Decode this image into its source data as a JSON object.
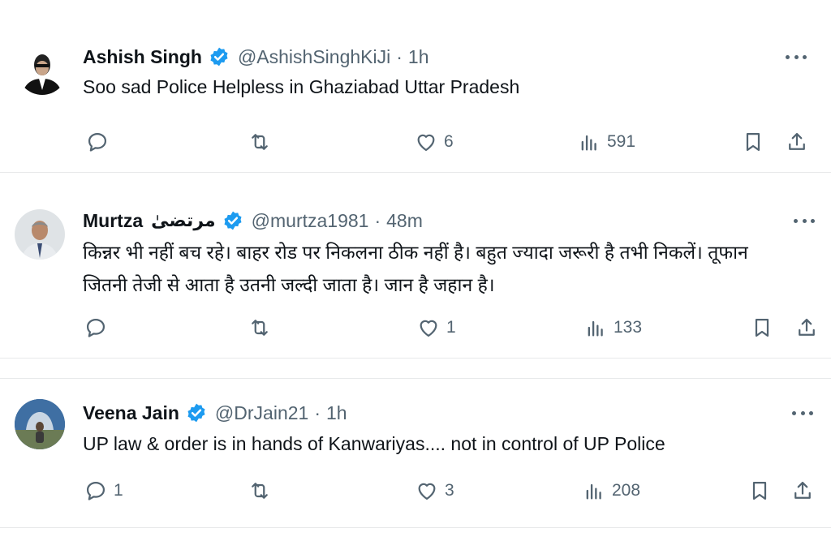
{
  "tweets": [
    {
      "name": "Ashish Singh",
      "name_alt": "",
      "handle": "@AshishSinghKiJi",
      "time": "1h",
      "text": "Soo sad Police Helpless in Ghaziabad Uttar Pradesh",
      "reply_count": "",
      "retweet_count": "",
      "like_count": "6",
      "view_count": "591"
    },
    {
      "name": "Murtza",
      "name_alt": "مرتضیٰ",
      "handle": "@murtza1981",
      "time": "48m",
      "text": "किन्नर भी नहीं बच रहे। बाहर रोड पर निकलना ठीक नहीं है। बहुत ज्यादा जरूरी है तभी निकलें। तूफान जितनी तेजी से आता है उतनी जल्दी जाता है। जान है जहान है।",
      "reply_count": "",
      "retweet_count": "",
      "like_count": "1",
      "view_count": "133"
    },
    {
      "name": "Veena Jain",
      "name_alt": "",
      "handle": "@DrJain21",
      "time": "1h",
      "text": "UP law & order is in hands of Kanwariyas.... not in control of UP Police",
      "reply_count": "1",
      "retweet_count": "",
      "like_count": "3",
      "view_count": "208"
    }
  ],
  "separator": "·",
  "colors": {
    "verified": "#1d9bf0",
    "muted": "#536471",
    "text": "#0f1419",
    "divider": "#e7e9ea"
  }
}
